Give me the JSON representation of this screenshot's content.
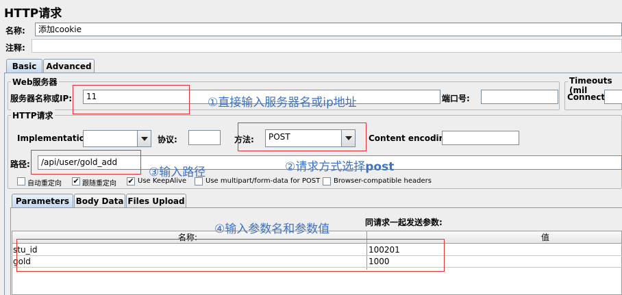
{
  "window": {
    "title": "HTTP请求"
  },
  "name_row": {
    "label": "名称:",
    "value": "添加cookie"
  },
  "comment_row": {
    "label": "注释:",
    "value": ""
  },
  "main_tabs": [
    {
      "label": "Basic",
      "active": true
    },
    {
      "label": "Advanced",
      "active": false
    }
  ],
  "web_server": {
    "title": "Web服务器",
    "server_label": "服务器名称或IP:",
    "server_value": "11",
    "port_label": "端口号:",
    "port_value": ""
  },
  "timeouts": {
    "title": "Timeouts (mil",
    "connect_label": "Connect:",
    "connect_value": ""
  },
  "http_request": {
    "title": "HTTP请求",
    "implementation_label": "Implementation:",
    "implementation_value": "",
    "protocol_label": "协议:",
    "protocol_value": "",
    "method_label": "方法:",
    "method_value": "POST",
    "encoding_label": "Content encoding:",
    "encoding_value": "",
    "path_label": "路径:",
    "path_value": "/api/user/gold_add"
  },
  "options": [
    {
      "label": "自动重定向",
      "checked": false
    },
    {
      "label": "跟随重定向",
      "checked": true
    },
    {
      "label": "Use KeepAlive",
      "checked": true
    },
    {
      "label": "Use multipart/form-data for POST",
      "checked": false
    },
    {
      "label": "Browser-compatible headers",
      "checked": false
    }
  ],
  "param_tabs": [
    {
      "label": "Parameters",
      "active": true
    },
    {
      "label": "Body Data",
      "active": false
    },
    {
      "label": "Files Upload",
      "active": false
    }
  ],
  "params_table": {
    "caption": "同请求一起发送参数:",
    "columns": [
      "名称:",
      "值"
    ],
    "rows": [
      {
        "name": "stu_id",
        "value": "100201"
      },
      {
        "name": "gold",
        "value": "1000"
      }
    ]
  },
  "annotations": {
    "note1": "①直接输入服务器名或ip地址",
    "note2_prefix": "②请求方式选择",
    "note2_bold": "post",
    "note3": "③输入路径",
    "note4": "④输入参数名和参数值"
  },
  "colors": {
    "annotation": "#3e72c4",
    "highlight_box": "#e53030",
    "active_tab": "#c5d8ee"
  }
}
